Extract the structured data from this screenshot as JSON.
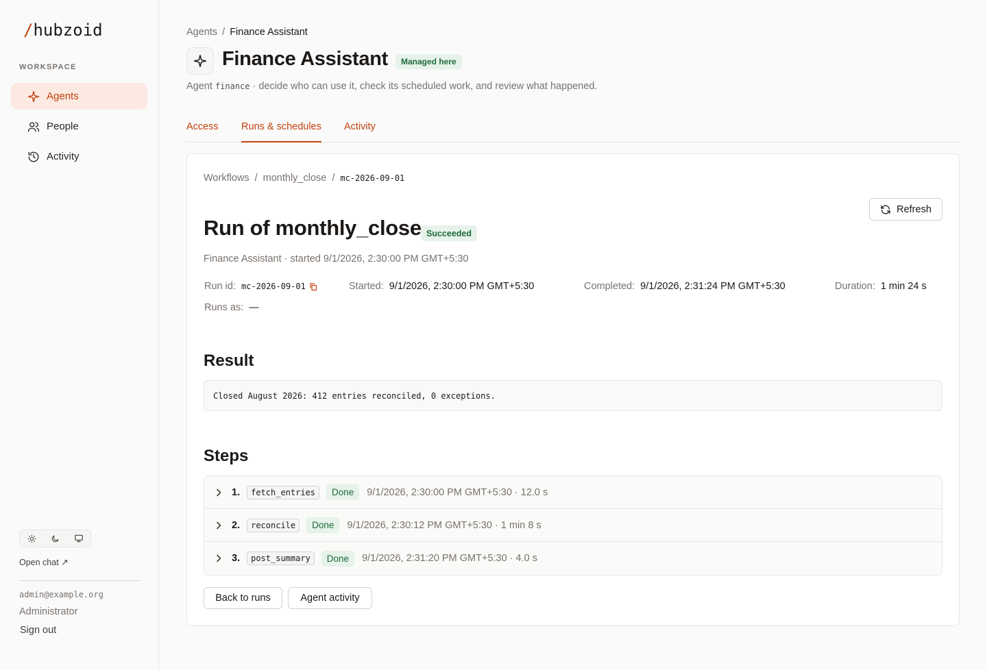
{
  "sidebar": {
    "logo_slash": "/",
    "logo_text": "hubzoid",
    "workspace_label": "WORKSPACE",
    "items": [
      {
        "label": "Agents",
        "icon": "sparkle-icon",
        "active": true
      },
      {
        "label": "People",
        "icon": "people-icon",
        "active": false
      },
      {
        "label": "Activity",
        "icon": "history-icon",
        "active": false
      }
    ],
    "theme_options": [
      "light",
      "dark",
      "system"
    ],
    "open_chat": "Open chat ↗",
    "user_email": "admin@example.org",
    "user_role": "Administrator",
    "sign_out": "Sign out"
  },
  "header": {
    "breadcrumb": [
      "Agents",
      "/",
      "Finance Assistant"
    ],
    "title": "Finance Assistant",
    "badge": "Managed here",
    "desc_prefix": "Agent",
    "desc_code": "finance",
    "desc_suffix": "· decide who can use it, check its scheduled work, and review what happened."
  },
  "tabs": [
    {
      "label": "Access",
      "active": false
    },
    {
      "label": "Runs & schedules",
      "active": true
    },
    {
      "label": "Activity",
      "active": false
    }
  ],
  "run": {
    "breadcrumb": [
      "Workflows",
      "/",
      "monthly_close",
      "/",
      "mc-2026-09-01"
    ],
    "refresh_label": "Refresh",
    "title": "Run of monthly_close",
    "status": "Succeeded",
    "subtitle": "Finance Assistant · started 9/1/2026, 2:30:00 PM GMT+5:30",
    "meta": {
      "run_id_label": "Run id",
      "run_id": "mc-2026-09-01",
      "started_label": "Started",
      "started": "9/1/2026, 2:30:00 PM GMT+5:30",
      "completed_label": "Completed",
      "completed": "9/1/2026, 2:31:24 PM GMT+5:30",
      "duration_label": "Duration",
      "duration": "1 min 24 s",
      "runs_as_label": "Runs as",
      "runs_as": "—"
    },
    "result_heading": "Result",
    "result_text": "Closed August 2026: 412 entries reconciled, 0 exceptions.",
    "steps_heading": "Steps",
    "steps": [
      {
        "num": "1.",
        "name": "fetch_entries",
        "status": "Done",
        "meta": "9/1/2026, 2:30:00 PM GMT+5:30 · 12.0 s"
      },
      {
        "num": "2.",
        "name": "reconcile",
        "status": "Done",
        "meta": "9/1/2026, 2:30:12 PM GMT+5:30 · 1 min 8 s"
      },
      {
        "num": "3.",
        "name": "post_summary",
        "status": "Done",
        "meta": "9/1/2026, 2:31:20 PM GMT+5:30 · 4.0 s"
      }
    ],
    "back_label": "Back to runs",
    "activity_label": "Agent activity"
  },
  "colors": {
    "accent": "#c2410c",
    "active_bg": "#fbe9e2",
    "success_bg": "#e6f2ea",
    "success_fg": "#1f6b3a"
  }
}
